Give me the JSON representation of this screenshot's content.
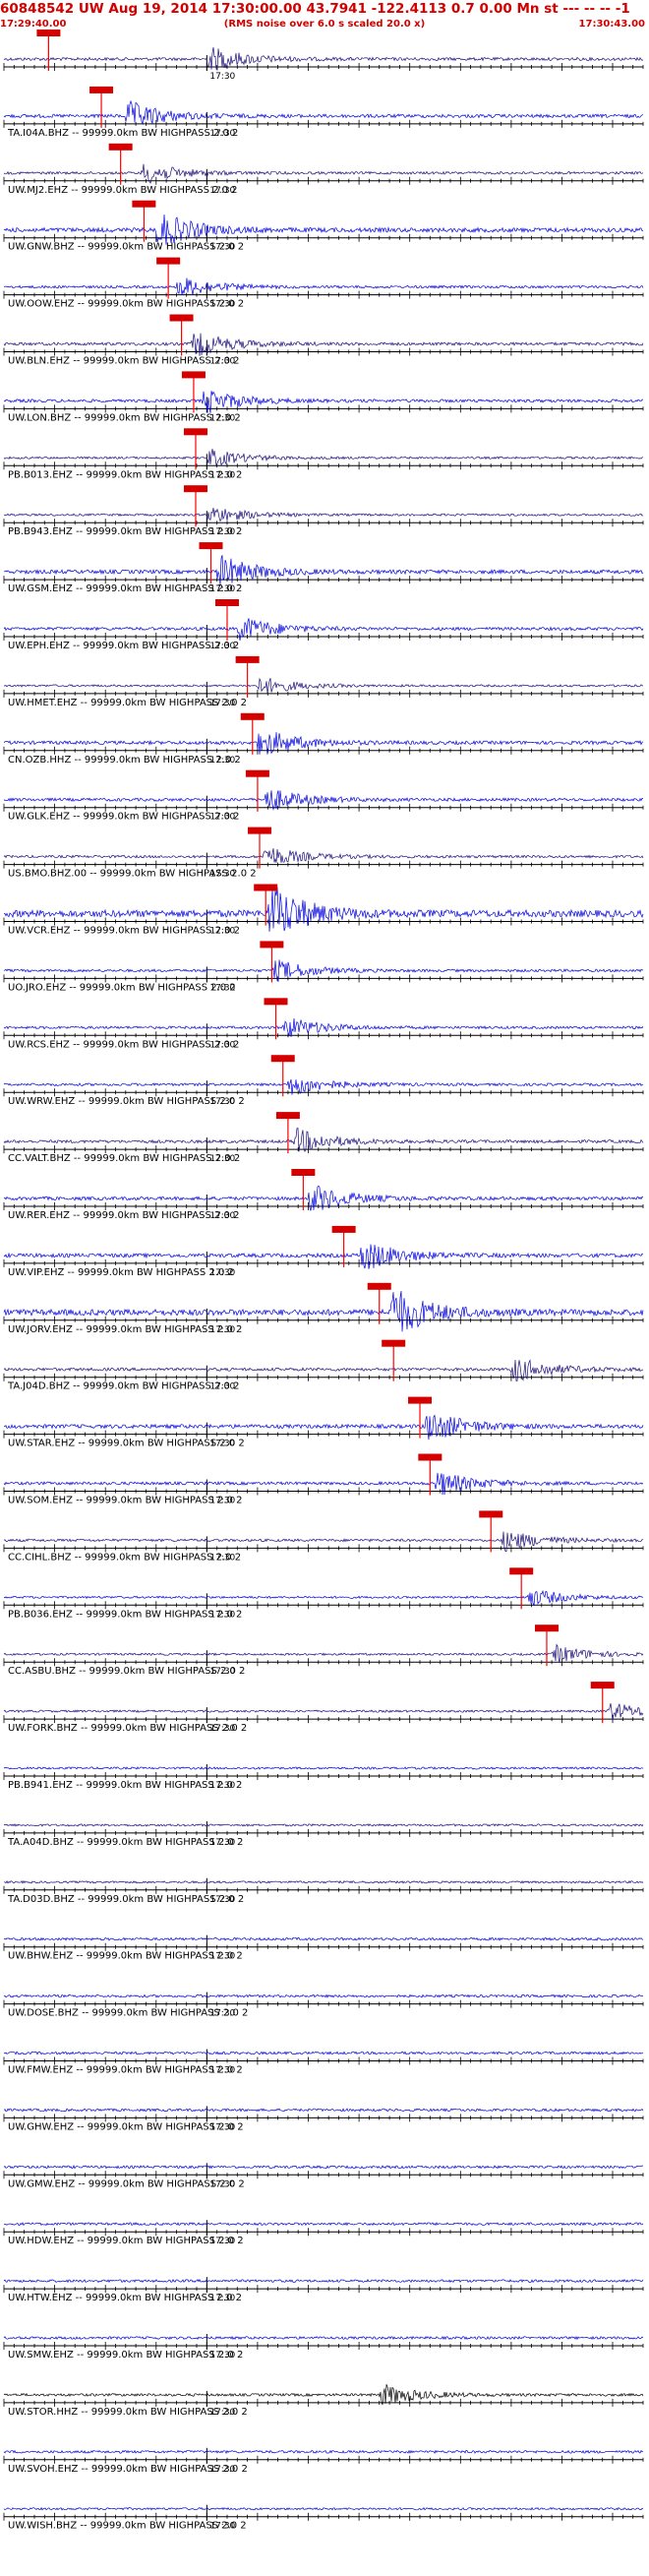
{
  "header": {
    "title": "60848542 UW Aug 19, 2014 17:30:00.00   43.7941 -122.4113  0.7 0.00 Mn st --- -- --  -1",
    "start_time": "17:29:40.00",
    "subtitle": "(RMS noise over 6.0 s scaled 20.0 x)",
    "end_time": "17:30:43.00"
  },
  "colors": {
    "header_text": "#d40000",
    "pick_fill": "#d40000",
    "pick_line": "#ff0000",
    "trace_blue": "#0000dd",
    "trace_navy": "#1a0d7a",
    "trace_black": "#000000",
    "axis": "#000000"
  },
  "chart_data": {
    "type": "line",
    "title": "60848542 UW Aug 19, 2014 17:30:00.00   43.7941 -122.4113  0.7 0.00 Mn st --- -- --  -1",
    "x_unit": "seconds from 17:29:40.00",
    "xlim": [
      0,
      63
    ],
    "minute_mark": {
      "t": 20,
      "label": "17:30"
    },
    "traces": [
      {
        "label": "",
        "color": "navy",
        "pick": 4.4,
        "burst": 20.0,
        "amp": 0.7
      },
      {
        "label": "TA.I04A.BHZ -- 99999.0km BW  HIGHPASS  2.0  2",
        "color": "blue",
        "pick": 9.6,
        "burst": 12.0,
        "amp": 0.8
      },
      {
        "label": "UW.MJ2.EHZ -- 99999.0km BW  HIGHPASS  2.0  2",
        "color": "navy",
        "pick": 11.5,
        "burst": 13.5,
        "amp": 0.6
      },
      {
        "label": "UW.GNW.BHZ -- 99999.0km BW  HIGHPASS  2.0  2",
        "color": "blue",
        "pick": 13.8,
        "burst": 15.0,
        "amp": 1.0
      },
      {
        "label": "UW.OOW.EHZ -- 99999.0km BW  HIGHPASS  2.0  2",
        "color": "blue",
        "pick": 16.2,
        "burst": 17.0,
        "amp": 0.6
      },
      {
        "label": "UW.BLN.EHZ -- 99999.0km BW  HIGHPASS  2.0  2",
        "color": "navy",
        "pick": 17.5,
        "burst": 18.5,
        "amp": 0.7
      },
      {
        "label": "UW.LON.BHZ -- 99999.0km BW  HIGHPASS  2.0  2",
        "color": "blue",
        "pick": 18.7,
        "burst": 19.5,
        "amp": 0.7
      },
      {
        "label": "PB.B013.EHZ -- 99999.0km BW  HIGHPASS  2.0  2",
        "color": "navy",
        "pick": 18.9,
        "burst": 20.0,
        "amp": 0.5
      },
      {
        "label": "PB.B943.EHZ -- 99999.0km BW  HIGHPASS  2.0  2",
        "color": "navy",
        "pick": 18.9,
        "burst": 20.0,
        "amp": 0.5
      },
      {
        "label": "UW.GSM.EHZ -- 99999.0km BW  HIGHPASS  2.0  2",
        "color": "blue",
        "pick": 20.4,
        "burst": 21.0,
        "amp": 0.9
      },
      {
        "label": "UW.EPH.EHZ -- 99999.0km BW  HIGHPASS  2.0  2",
        "color": "blue",
        "pick": 22.0,
        "burst": 23.0,
        "amp": 0.7
      },
      {
        "label": "UW.HMET.EHZ -- 99999.0km BW  HIGHPASS  2.0  2",
        "color": "navy",
        "pick": 24.0,
        "burst": 25.0,
        "amp": 0.5
      },
      {
        "label": "CN.OZB.HHZ -- 99999.0km BW  HIGHPASS  2.0  2",
        "color": "blue",
        "pick": 24.5,
        "burst": 25.0,
        "amp": 0.8
      },
      {
        "label": "UW.GLK.EHZ -- 99999.0km BW  HIGHPASS  2.0  2",
        "color": "blue",
        "pick": 25.0,
        "burst": 25.5,
        "amp": 0.7
      },
      {
        "label": "US.BMO.BHZ.00 -- 99999.0km BW  HIGHPASS  2.0  2",
        "color": "navy",
        "pick": 25.2,
        "burst": 25.5,
        "amp": 0.6
      },
      {
        "label": "UW.VCR.EHZ -- 99999.0km BW  HIGHPASS  2.0  2",
        "color": "blue",
        "pick": 25.8,
        "burst": 26.0,
        "amp": 1.6
      },
      {
        "label": "UO.JRO.EHZ -- 99999.0km BW  HIGHPASS  2.0  2",
        "color": "blue",
        "pick": 26.4,
        "burst": 26.5,
        "amp": 0.6
      },
      {
        "label": "UW.RCS.EHZ -- 99999.0km BW  HIGHPASS  2.0  2",
        "color": "blue",
        "pick": 26.8,
        "burst": 27.5,
        "amp": 0.6
      },
      {
        "label": "UW.WRW.EHZ -- 99999.0km BW  HIGHPASS  2.0  2",
        "color": "blue",
        "pick": 27.5,
        "burst": 28.0,
        "amp": 0.6
      },
      {
        "label": "CC.VALT.BHZ -- 99999.0km BW  HIGHPASS  2.0  2",
        "color": "navy",
        "pick": 28.0,
        "burst": 28.5,
        "amp": 0.7
      },
      {
        "label": "UW.RER.EHZ -- 99999.0km BW  HIGHPASS  2.0  2",
        "color": "blue",
        "pick": 29.5,
        "burst": 30.0,
        "amp": 0.8
      },
      {
        "label": "UW.VIP.EHZ -- 99999.0km BW  HIGHPASS  2.0  2",
        "color": "blue",
        "pick": 33.5,
        "burst": 35.0,
        "amp": 0.9
      },
      {
        "label": "UW.JORV.EHZ -- 99999.0km BW  HIGHPASS  2.0  2",
        "color": "blue",
        "pick": 37.0,
        "burst": 38.0,
        "amp": 1.4
      },
      {
        "label": "TA.J04D.BHZ -- 99999.0km BW  HIGHPASS  2.0  2",
        "color": "navy",
        "pick": 38.4,
        "burst": 50.0,
        "amp": 0.7
      },
      {
        "label": "UW.STAR.EHZ -- 99999.0km BW  HIGHPASS  2.0  2",
        "color": "blue",
        "pick": 41.0,
        "burst": 41.5,
        "amp": 0.9
      },
      {
        "label": "UW.SOM.EHZ -- 99999.0km BW  HIGHPASS  2.0  2",
        "color": "blue",
        "pick": 42.0,
        "burst": 42.5,
        "amp": 0.7
      },
      {
        "label": "CC.CIHL.BHZ -- 99999.0km BW  HIGHPASS  2.0  2",
        "color": "navy",
        "pick": 48.0,
        "burst": 49.0,
        "amp": 0.6
      },
      {
        "label": "PB.B036.EHZ -- 99999.0km BW  HIGHPASS  2.0  2",
        "color": "blue",
        "pick": 51.0,
        "burst": 51.5,
        "amp": 0.5
      },
      {
        "label": "CC.ASBU.BHZ -- 99999.0km BW  HIGHPASS  2.0  2",
        "color": "navy",
        "pick": 53.5,
        "burst": 54.0,
        "amp": 0.5
      },
      {
        "label": "UW.FORK.BHZ -- 99999.0km BW  HIGHPASS  2.0  2",
        "color": "navy",
        "pick": 59.0,
        "burst": 59.5,
        "amp": 0.5
      },
      {
        "label": "PB.B941.EHZ -- 99999.0km BW  HIGHPASS  2.0  2",
        "color": "blue",
        "pick": null,
        "burst": null,
        "amp": 0.5
      },
      {
        "label": "TA.A04D.BHZ -- 99999.0km BW  HIGHPASS  2.0  2",
        "color": "navy",
        "pick": null,
        "burst": null,
        "amp": 0.5
      },
      {
        "label": "TA.D03D.BHZ -- 99999.0km BW  HIGHPASS  2.0  2",
        "color": "navy",
        "pick": null,
        "burst": null,
        "amp": 0.5
      },
      {
        "label": "UW.BHW.EHZ -- 99999.0km BW  HIGHPASS  2.0  2",
        "color": "blue",
        "pick": null,
        "burst": null,
        "amp": 0.6
      },
      {
        "label": "UW.DOSE.BHZ -- 99999.0km BW  HIGHPASS  2.0  2",
        "color": "blue",
        "pick": null,
        "burst": null,
        "amp": 0.6
      },
      {
        "label": "UW.FMW.EHZ -- 99999.0km BW  HIGHPASS  2.0  2",
        "color": "blue",
        "pick": null,
        "burst": null,
        "amp": 0.6
      },
      {
        "label": "UW.GHW.EHZ -- 99999.0km BW  HIGHPASS  2.0  2",
        "color": "blue",
        "pick": null,
        "burst": null,
        "amp": 0.6
      },
      {
        "label": "UW.GMW.EHZ -- 99999.0km BW  HIGHPASS  2.0  2",
        "color": "blue",
        "pick": null,
        "burst": null,
        "amp": 0.6
      },
      {
        "label": "UW.HDW.EHZ -- 99999.0km BW  HIGHPASS  2.0  2",
        "color": "blue",
        "pick": null,
        "burst": null,
        "amp": 0.6
      },
      {
        "label": "UW.HTW.EHZ -- 99999.0km BW  HIGHPASS  2.0  2",
        "color": "blue",
        "pick": null,
        "burst": null,
        "amp": 0.6
      },
      {
        "label": "UW.SMW.EHZ -- 99999.0km BW  HIGHPASS  2.0  2",
        "color": "blue",
        "pick": null,
        "burst": null,
        "amp": 0.6
      },
      {
        "label": "UW.STOR.HHZ -- 99999.0km BW  HIGHPASS  2.0  2",
        "color": "black",
        "pick": null,
        "burst": 37.0,
        "amp": 0.6
      },
      {
        "label": "UW.SVOH.EHZ -- 99999.0km BW  HIGHPASS  2.0  2",
        "color": "blue",
        "pick": null,
        "burst": null,
        "amp": 0.6
      },
      {
        "label": "UW.WISH.BHZ -- 99999.0km BW  HIGHPASS  2.0  2",
        "color": "blue",
        "pick": null,
        "burst": null,
        "amp": 0.5
      }
    ]
  }
}
